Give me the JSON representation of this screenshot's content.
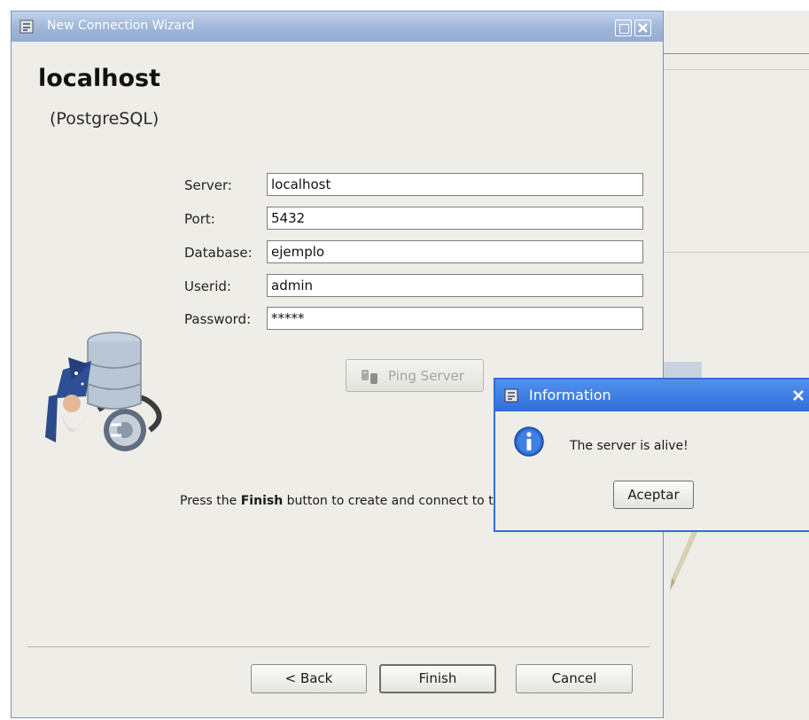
{
  "wizard": {
    "window_title": "New Connection Wizard",
    "connection_name": "localhost",
    "connection_type": "(PostgreSQL)",
    "fields": [
      {
        "label": "Server:",
        "value": "localhost"
      },
      {
        "label": "Port:",
        "value": "5432"
      },
      {
        "label": "Database:",
        "value": "ejemplo"
      },
      {
        "label": "Userid:",
        "value": "admin"
      },
      {
        "label": "Password:",
        "value": "*****"
      }
    ],
    "ping_label": "Ping Server",
    "finish_text_before": "Press the ",
    "finish_text_bold": "Finish",
    "finish_text_after": " button to create and connect to this connection.",
    "back_label": "< Back",
    "finish_label": "Finish",
    "cancel_label": "Cancel"
  },
  "dialog": {
    "title": "Information",
    "message": "The server is alive!",
    "ok_label": "Aceptar"
  },
  "colors": {
    "titlebar": "#9fb6d8",
    "dialog_titlebar": "#2e6fda",
    "window_bg": "#eeede8"
  },
  "icons": {
    "app": "database-window-icon",
    "ping": "ping-server-icon",
    "wizard": "wizard-database-plug-icon",
    "info": "info-icon"
  }
}
